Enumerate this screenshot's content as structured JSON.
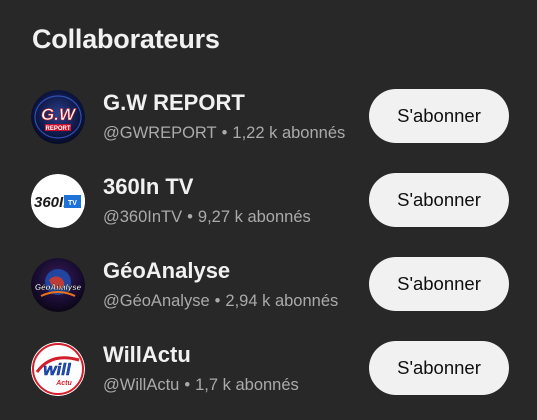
{
  "section": {
    "title": "Collaborateurs",
    "separator": "•",
    "subscribe_label": "S'abonner"
  },
  "channels": [
    {
      "name": "G.W REPORT",
      "handle": "@GWREPORT",
      "subscribers": "1,22 k abonnés",
      "icon": "gw-report-logo",
      "avatar_text": "G.W",
      "avatar_subtext": "REPORT"
    },
    {
      "name": "360In TV",
      "handle": "@360InTV",
      "subscribers": "9,27 k abonnés",
      "icon": "360in-tv-logo",
      "avatar_text": "360In",
      "avatar_subtext": "TV"
    },
    {
      "name": "GéoAnalyse",
      "handle": "@GéoAnalyse",
      "subscribers": "2,94 k abonnés",
      "icon": "geoanalyse-logo",
      "avatar_text": "GéoAnalyse"
    },
    {
      "name": "WillActu",
      "handle": "@WillActu",
      "subscribers": "1,7 k abonnés",
      "icon": "willactu-logo",
      "avatar_text": "will",
      "avatar_subtext": "Actu"
    }
  ]
}
